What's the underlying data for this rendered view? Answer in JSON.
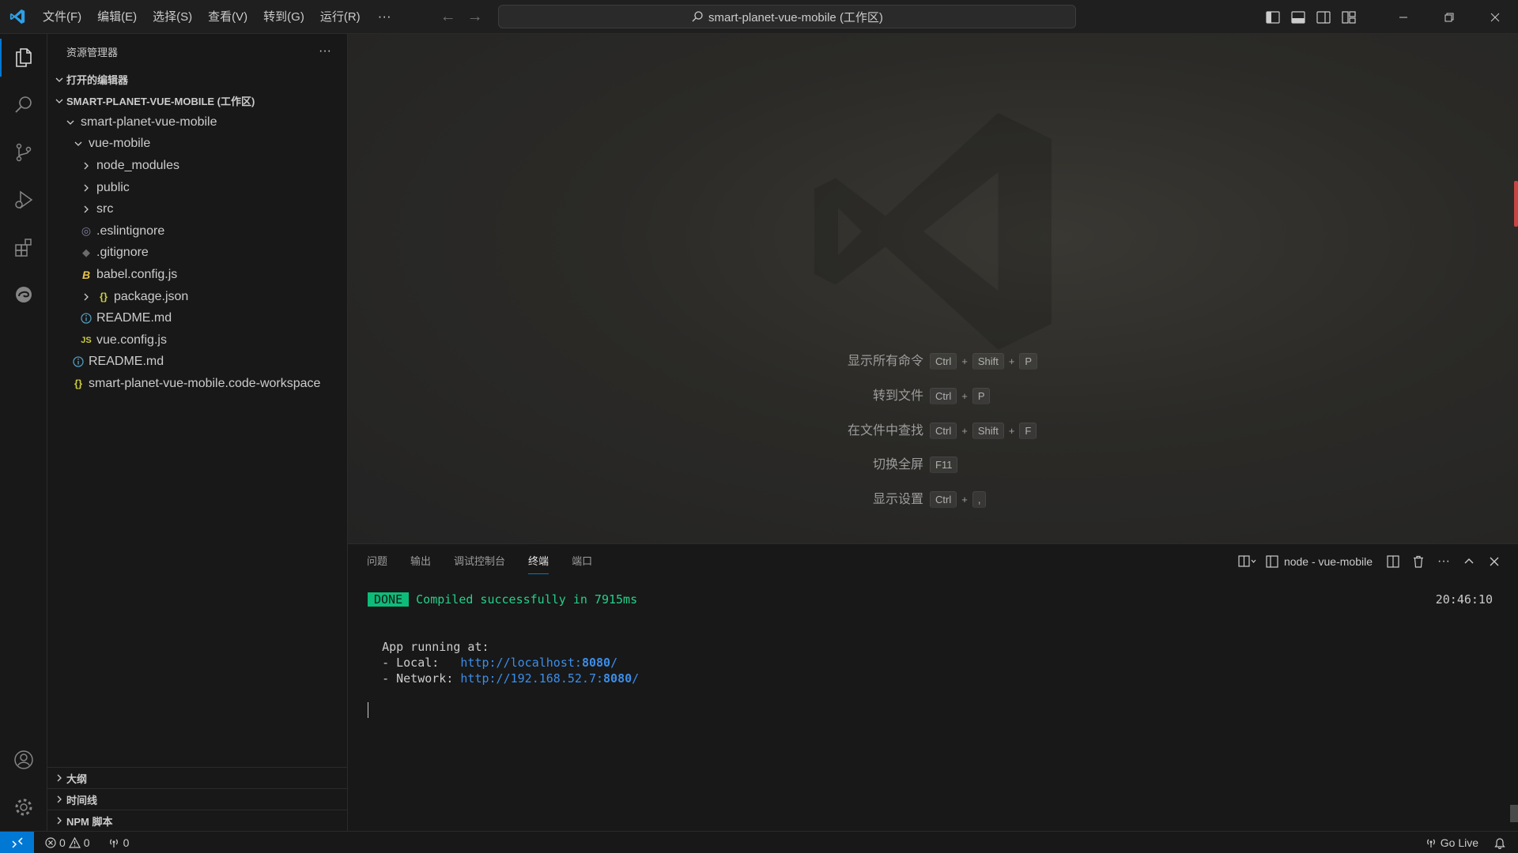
{
  "menu": {
    "items": [
      "文件(F)",
      "编辑(E)",
      "选择(S)",
      "查看(V)",
      "转到(G)",
      "运行(R)"
    ],
    "more": "···"
  },
  "command_center": {
    "text": "smart-planet-vue-mobile (工作区)"
  },
  "sidebar": {
    "title": "资源管理器",
    "more": "···",
    "open_editors": "打开的编辑器",
    "workspace": "SMART-PLANET-VUE-MOBILE (工作区)",
    "tree": [
      {
        "label": "smart-planet-vue-mobile",
        "depth": 1,
        "kind": "folder-open"
      },
      {
        "label": "vue-mobile",
        "depth": 2,
        "kind": "folder-open"
      },
      {
        "label": "node_modules",
        "depth": 3,
        "kind": "folder"
      },
      {
        "label": "public",
        "depth": 3,
        "kind": "folder"
      },
      {
        "label": "src",
        "depth": 3,
        "kind": "folder"
      },
      {
        "label": ".eslintignore",
        "depth": 3,
        "kind": "file-eslint"
      },
      {
        "label": ".gitignore",
        "depth": 3,
        "kind": "file-git"
      },
      {
        "label": "babel.config.js",
        "depth": 3,
        "kind": "file-babel"
      },
      {
        "label": "package.json",
        "depth": 3,
        "kind": "json-folder"
      },
      {
        "label": "README.md",
        "depth": 3,
        "kind": "file-info"
      },
      {
        "label": "vue.config.js",
        "depth": 3,
        "kind": "file-js"
      },
      {
        "label": "README.md",
        "depth": 2,
        "kind": "file-info"
      },
      {
        "label": "smart-planet-vue-mobile.code-workspace",
        "depth": 2,
        "kind": "file-json"
      }
    ],
    "bottom_sections": [
      "大纲",
      "时间线",
      "NPM 脚本"
    ]
  },
  "editor": {
    "shortcuts": [
      {
        "label": "显示所有命令",
        "keys": [
          "Ctrl",
          "Shift",
          "P"
        ]
      },
      {
        "label": "转到文件",
        "keys": [
          "Ctrl",
          "P"
        ]
      },
      {
        "label": "在文件中查找",
        "keys": [
          "Ctrl",
          "Shift",
          "F"
        ]
      },
      {
        "label": "切换全屏",
        "keys": [
          "F11"
        ]
      },
      {
        "label": "显示设置",
        "keys": [
          "Ctrl",
          ","
        ]
      }
    ]
  },
  "panel": {
    "tabs": [
      "问题",
      "输出",
      "调试控制台",
      "终端",
      "端口"
    ],
    "active_tab": 3,
    "terminal_name": "node - vue-mobile",
    "terminal": {
      "done": "DONE",
      "compiled": "Compiled successfully in 7915ms",
      "time": "20:46:10",
      "app_running": "App running at:",
      "local_label": "- Local:   ",
      "local_url_prefix": "http://localhost:",
      "local_port": "8080",
      "local_url_suffix": "/",
      "network_label": "- Network: ",
      "network_url_prefix": "http://192.168.52.7:",
      "network_port": "8080",
      "network_url_suffix": "/"
    }
  },
  "statusbar": {
    "errors": "0",
    "warnings": "0",
    "ports": "0",
    "go_live": "Go Live"
  },
  "colors": {
    "accent": "#0078d4",
    "done_badge": "#0dbc79",
    "success_text": "#23d18b",
    "link": "#3b8eea"
  }
}
